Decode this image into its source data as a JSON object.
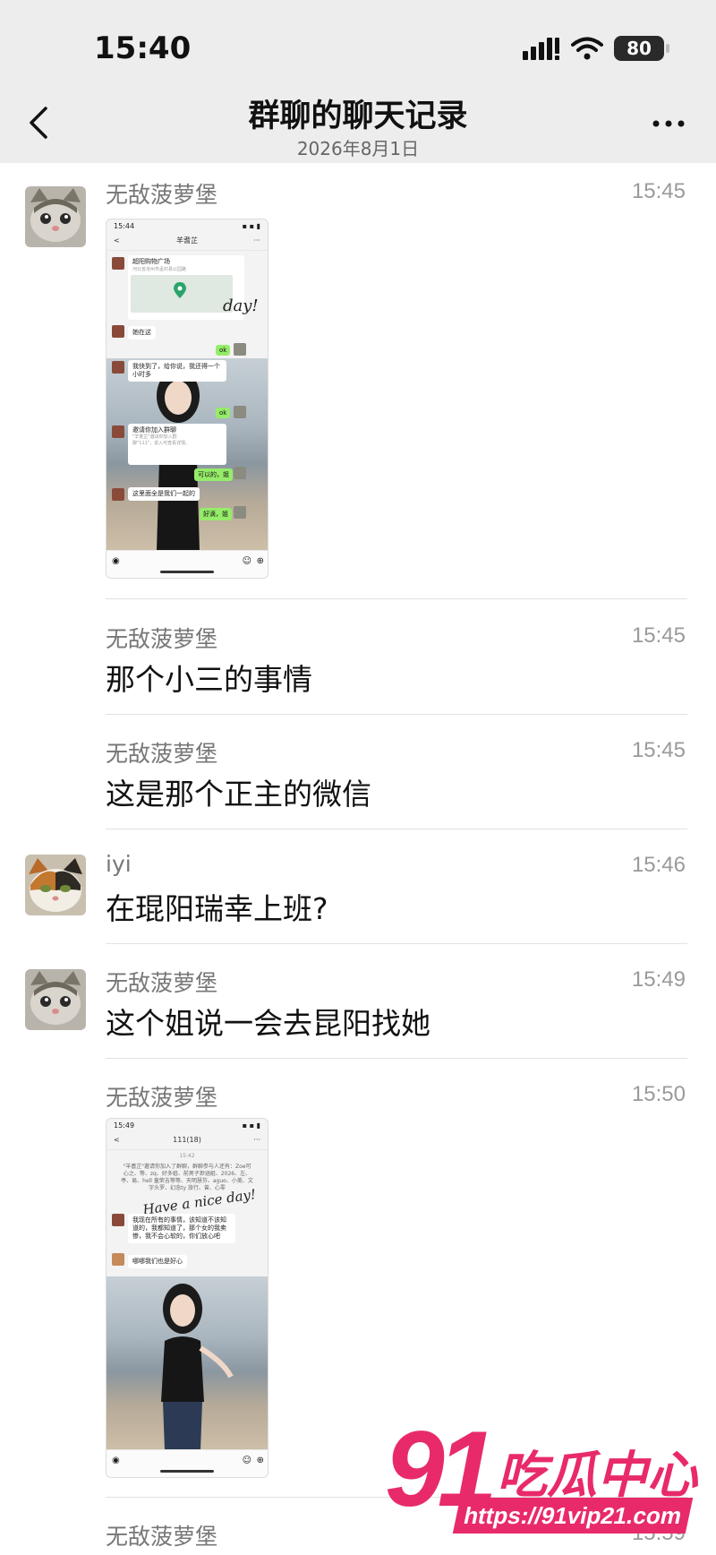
{
  "status": {
    "time": "15:40",
    "battery": "80"
  },
  "nav": {
    "title": "群聊的聊天记录",
    "date": "2026年8月1日"
  },
  "messages": [
    {
      "sender": "无敌菠萝堡",
      "time": "15:45"
    },
    {
      "sender": "无敌菠萝堡",
      "time": "15:45",
      "text": "那个小三的事情"
    },
    {
      "sender": "无敌菠萝堡",
      "time": "15:45",
      "text": "这是那个正主的微信"
    },
    {
      "sender": "iyi",
      "time": "15:46",
      "text": "在琨阳瑞幸上班?"
    },
    {
      "sender": "无敌菠萝堡",
      "time": "15:49",
      "text": "这个姐说一会去昆阳找她"
    },
    {
      "sender": "无敌菠萝堡",
      "time": "15:50"
    },
    {
      "sender": "无敌菠萝堡",
      "time": "15:59"
    }
  ],
  "shot1": {
    "status_time": "15:44",
    "title": "羊耆芷",
    "location_title": "超阳购物广场",
    "location_addr": "河北省沧州市孟村县公园路",
    "msg_here": "她在这",
    "ok1": "ok",
    "msg_found": "我快到了，给你说，我还得一个小时多",
    "ok2": "ok",
    "invite_title": "邀请你加入群聊",
    "invite_desc": "\"羊耆芷\"邀请你加入群聊\"111\"，进入可查看详情。",
    "reply_ok": "可以的，姐",
    "msg_all": "这里面全是我们一起的",
    "reply_good": "好滴，姐",
    "deco": "day!"
  },
  "shot2": {
    "status_time": "15:49",
    "title": "111(18)",
    "sys_time": "15:42",
    "sys_msg": "\"羊耆芷\"邀请你加入了群聊，群聊参与人还有：Zoe可心之、等、zq、好多姐、前男子渺涵姐、2026、左、亭、易、hell 童荣吉等等、天明慧芬、aguo、小美、文字头罗、幻念ty 旅行、曾、心零",
    "deco": "Have a nice day!",
    "msg_long": "我现在所有的事情，该知道不该知道的，我都知道了，那个女的我卖惨，我不会心软的，你们放心吧",
    "msg_short": "哪哪我们也是好心"
  },
  "watermark": {
    "big": "91",
    "cn": "吃瓜中心",
    "url": "https://91vip21.com"
  }
}
